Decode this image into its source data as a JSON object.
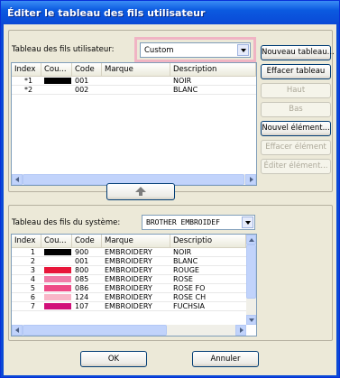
{
  "window": {
    "title": "Éditer le tableau des fils utilisateur"
  },
  "user_table": {
    "label": "Tableau des fils utilisateur:",
    "selected": "Custom",
    "columns": [
      "Index",
      "Cou...",
      "Code",
      "Marque",
      "Description"
    ],
    "rows": [
      {
        "index": "*1",
        "color": "#000000",
        "code": "001",
        "brand": "",
        "description": "NOIR"
      },
      {
        "index": "*2",
        "color": "#ffffff",
        "code": "002",
        "brand": "",
        "description": "BLANC"
      }
    ]
  },
  "buttons": {
    "new_table": "Nouveau tableau...",
    "delete_table": "Effacer tableau",
    "up": "Haut",
    "down": "Bas",
    "new_element": "Nouvel élément...",
    "delete_element": "Effacer élément",
    "edit_element": "Éditer élément...",
    "ok": "OK",
    "cancel": "Annuler"
  },
  "system_table": {
    "label": "Tableau des fils du système:",
    "selected": "BROTHER EMBROIDEF",
    "columns": [
      "Index",
      "Cou...",
      "Code",
      "Marque",
      "Descriptio"
    ],
    "rows": [
      {
        "index": "1",
        "color": "#000000",
        "code": "900",
        "brand": "EMBROIDERY",
        "description": "NOIR"
      },
      {
        "index": "2",
        "color": "#ffffff",
        "code": "001",
        "brand": "EMBROIDERY",
        "description": "BLANC"
      },
      {
        "index": "3",
        "color": "#e8163a",
        "code": "800",
        "brand": "EMBROIDERY",
        "description": "ROUGE"
      },
      {
        "index": "4",
        "color": "#f07ca8",
        "code": "085",
        "brand": "EMBROIDERY",
        "description": "ROSE"
      },
      {
        "index": "5",
        "color": "#ee4a86",
        "code": "086",
        "brand": "EMBROIDERY",
        "description": "ROSE FO"
      },
      {
        "index": "6",
        "color": "#f9b6c8",
        "code": "124",
        "brand": "EMBROIDERY",
        "description": "ROSE CH"
      },
      {
        "index": "7",
        "color": "#d1107a",
        "code": "107",
        "brand": "EMBROIDERY",
        "description": "FUCHSIA"
      }
    ]
  },
  "colors": {
    "highlight": "#f0b4c4",
    "titlebar": "#0a49d6"
  }
}
